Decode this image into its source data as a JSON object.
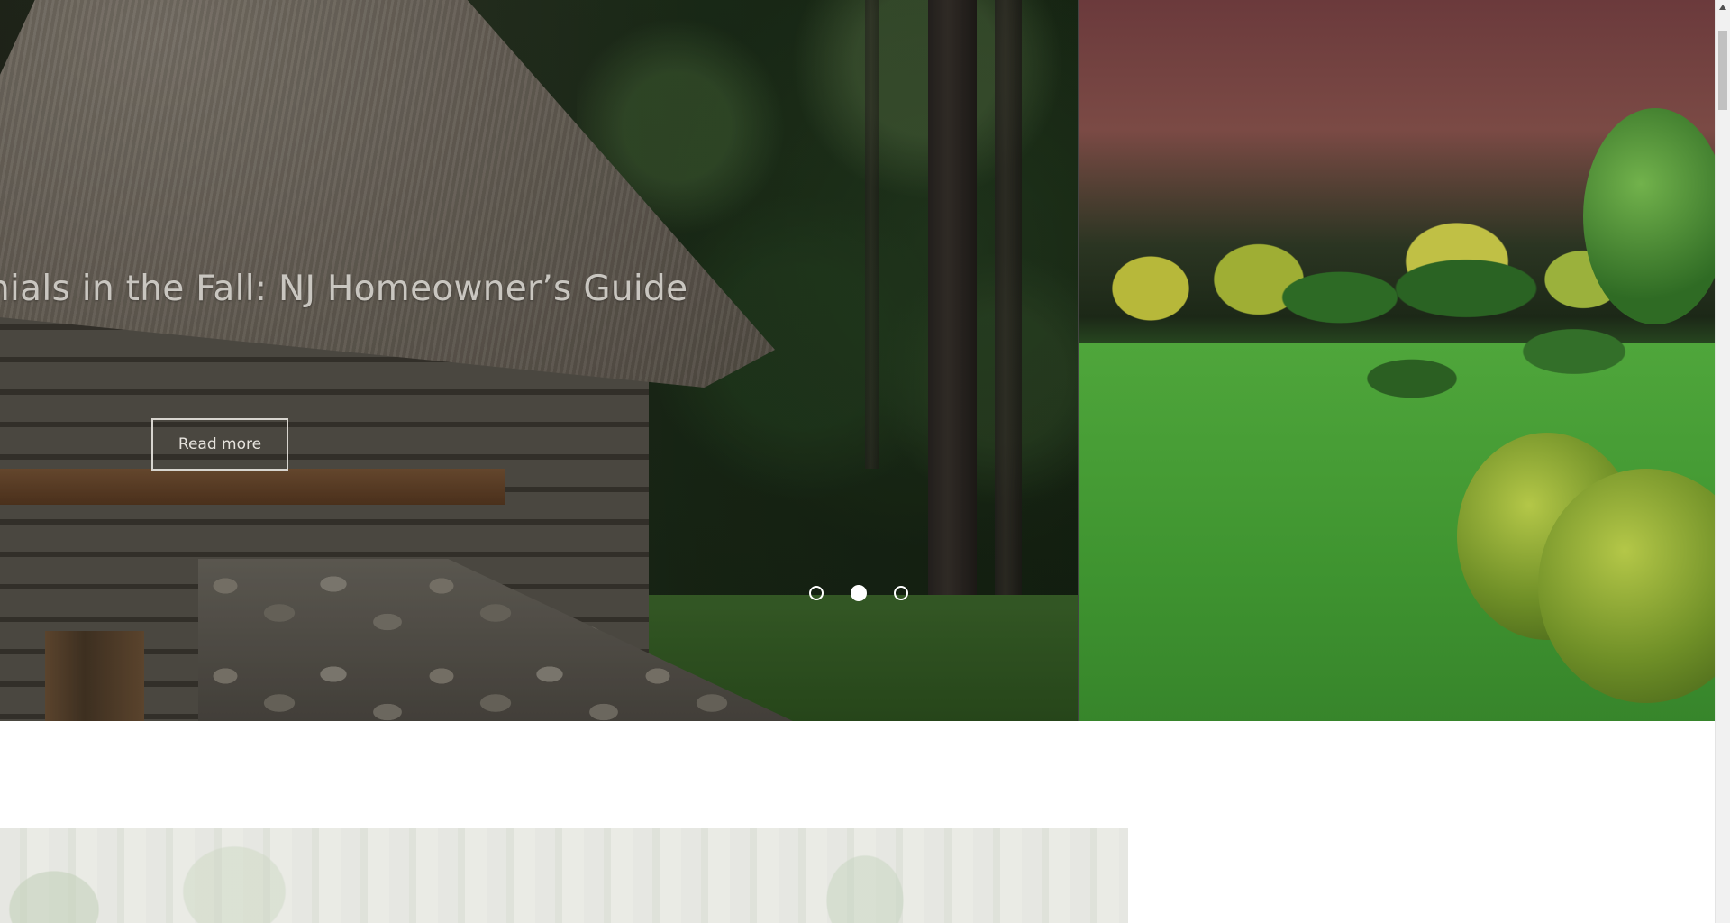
{
  "hero": {
    "slide_title": "nials in the Fall: NJ Homeowner’s Guide",
    "read_more_label": "Read more",
    "active_slide": 2,
    "slide_count": 3
  },
  "scrollbar": {
    "up_arrow_icon": "triangle-up-icon"
  }
}
